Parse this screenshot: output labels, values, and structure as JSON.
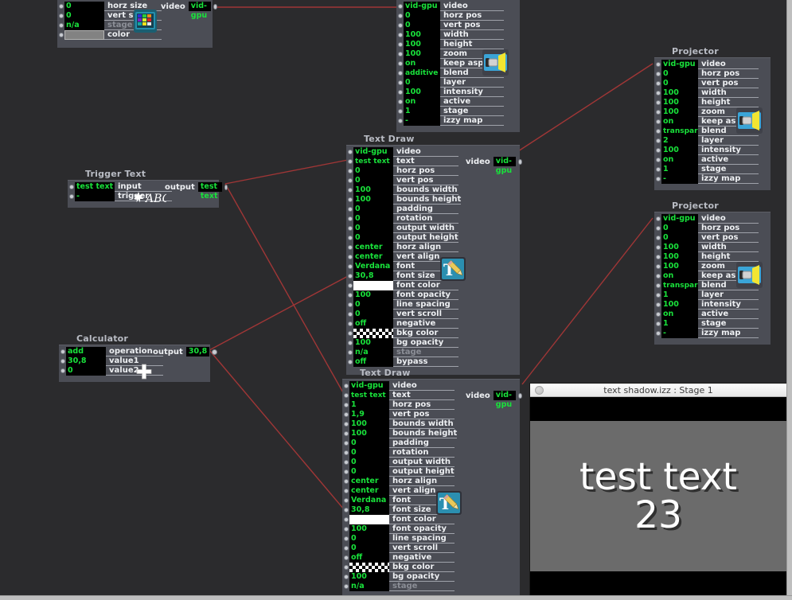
{
  "app": {
    "canvas_bg": "#2b2b2d",
    "node_bg": "#4b4d55",
    "value_color": "#19e23b",
    "wire_color": "#a03636"
  },
  "nodes": {
    "color_gen": {
      "title": "",
      "rows": [
        {
          "value": "0",
          "label": "horz size",
          "type": "text"
        },
        {
          "value": "0",
          "label": "vert size",
          "type": "text"
        },
        {
          "value": "n/a",
          "label": "stage",
          "type": "text",
          "dim": true
        },
        {
          "value": "",
          "label": "color",
          "type": "swatch-grey"
        }
      ],
      "output": {
        "label": "video",
        "value": "vid-gpu"
      },
      "icon": "color-grid-icon"
    },
    "projector_top_left": {
      "title": "",
      "rows": [
        {
          "value": "vid-gpu",
          "label": "video"
        },
        {
          "value": "0",
          "label": "horz pos"
        },
        {
          "value": "0",
          "label": "vert pos"
        },
        {
          "value": "100",
          "label": "width"
        },
        {
          "value": "100",
          "label": "height"
        },
        {
          "value": "100",
          "label": "zoom"
        },
        {
          "value": "on",
          "label": "keep aspect"
        },
        {
          "value": "additive",
          "label": "blend"
        },
        {
          "value": "0",
          "label": "layer"
        },
        {
          "value": "100",
          "label": "intensity"
        },
        {
          "value": "on",
          "label": "active"
        },
        {
          "value": "1",
          "label": "stage"
        },
        {
          "value": "-",
          "label": "izzy map"
        }
      ],
      "icon": "projector-icon"
    },
    "trigger_text": {
      "title": "Trigger Text",
      "rows": [
        {
          "value": "test text",
          "label": "input"
        },
        {
          "value": "-",
          "label": "trigger"
        }
      ],
      "output": {
        "label": "output",
        "value": "test text"
      },
      "icon": "abc-icon"
    },
    "calculator": {
      "title": "Calculator",
      "rows": [
        {
          "value": "add",
          "label": "operation"
        },
        {
          "value": "30,8",
          "label": "value1"
        },
        {
          "value": "0",
          "label": "value2"
        }
      ],
      "output": {
        "label": "output",
        "value": "30,8"
      },
      "icon": "plus-icon"
    },
    "text_draw_top": {
      "title": "Text Draw",
      "rows": [
        {
          "value": "vid-gpu",
          "label": "video"
        },
        {
          "value": "test text",
          "label": "text"
        },
        {
          "value": "0",
          "label": "horz pos"
        },
        {
          "value": "0",
          "label": "vert pos"
        },
        {
          "value": "100",
          "label": "bounds width"
        },
        {
          "value": "100",
          "label": "bounds height"
        },
        {
          "value": "0",
          "label": "padding"
        },
        {
          "value": "0",
          "label": "rotation"
        },
        {
          "value": "0",
          "label": "output width"
        },
        {
          "value": "0",
          "label": "output height"
        },
        {
          "value": "center",
          "label": "horz align"
        },
        {
          "value": "center",
          "label": "vert align"
        },
        {
          "value": "Verdana",
          "label": "font"
        },
        {
          "value": "30,8",
          "label": "font size"
        },
        {
          "value": "",
          "label": "font color",
          "type": "swatch-white"
        },
        {
          "value": "100",
          "label": "font opacity"
        },
        {
          "value": "0",
          "label": "line spacing"
        },
        {
          "value": "0",
          "label": "vert scroll"
        },
        {
          "value": "off",
          "label": "negative"
        },
        {
          "value": "",
          "label": "bkg color",
          "type": "swatch-checker"
        },
        {
          "value": "100",
          "label": "bg opacity"
        },
        {
          "value": "n/a",
          "label": "stage",
          "dim": true
        },
        {
          "value": "off",
          "label": "bypass"
        }
      ],
      "output": {
        "label": "video",
        "value": "vid-gpu"
      },
      "icon": "text-edit-icon"
    },
    "text_draw_bottom": {
      "title": "Text Draw",
      "rows": [
        {
          "value": "vid-gpu",
          "label": "video"
        },
        {
          "value": "test text",
          "label": "text"
        },
        {
          "value": "1",
          "label": "horz pos"
        },
        {
          "value": "1,9",
          "label": "vert pos"
        },
        {
          "value": "100",
          "label": "bounds width"
        },
        {
          "value": "100",
          "label": "bounds height"
        },
        {
          "value": "0",
          "label": "padding"
        },
        {
          "value": "0",
          "label": "rotation"
        },
        {
          "value": "0",
          "label": "output width"
        },
        {
          "value": "0",
          "label": "output height"
        },
        {
          "value": "center",
          "label": "horz align"
        },
        {
          "value": "center",
          "label": "vert align"
        },
        {
          "value": "Verdana",
          "label": "font"
        },
        {
          "value": "30,8",
          "label": "font size"
        },
        {
          "value": "",
          "label": "font color",
          "type": "swatch-white"
        },
        {
          "value": "100",
          "label": "font opacity"
        },
        {
          "value": "0",
          "label": "line spacing"
        },
        {
          "value": "0",
          "label": "vert scroll"
        },
        {
          "value": "off",
          "label": "negative"
        },
        {
          "value": "",
          "label": "bkg color",
          "type": "swatch-checker"
        },
        {
          "value": "100",
          "label": "bg opacity"
        },
        {
          "value": "n/a",
          "label": "stage",
          "dim": true
        }
      ],
      "output": {
        "label": "video",
        "value": "vid-gpu"
      },
      "icon": "text-edit-icon"
    },
    "projector_1": {
      "title": "Projector",
      "rows": [
        {
          "value": "vid-gpu",
          "label": "video"
        },
        {
          "value": "0",
          "label": "horz pos"
        },
        {
          "value": "0",
          "label": "vert pos"
        },
        {
          "value": "100",
          "label": "width"
        },
        {
          "value": "100",
          "label": "height"
        },
        {
          "value": "100",
          "label": "zoom"
        },
        {
          "value": "on",
          "label": "keep aspect"
        },
        {
          "value": "transpar",
          "label": "blend"
        },
        {
          "value": "2",
          "label": "layer"
        },
        {
          "value": "100",
          "label": "intensity"
        },
        {
          "value": "on",
          "label": "active"
        },
        {
          "value": "1",
          "label": "stage"
        },
        {
          "value": "-",
          "label": "izzy map"
        }
      ],
      "icon": "projector-icon"
    },
    "projector_2": {
      "title": "Projector",
      "rows": [
        {
          "value": "vid-gpu",
          "label": "video"
        },
        {
          "value": "0",
          "label": "horz pos"
        },
        {
          "value": "0",
          "label": "vert pos"
        },
        {
          "value": "100",
          "label": "width"
        },
        {
          "value": "100",
          "label": "height"
        },
        {
          "value": "100",
          "label": "zoom"
        },
        {
          "value": "on",
          "label": "keep aspect"
        },
        {
          "value": "transpar",
          "label": "blend"
        },
        {
          "value": "1",
          "label": "layer"
        },
        {
          "value": "100",
          "label": "intensity"
        },
        {
          "value": "on",
          "label": "active"
        },
        {
          "value": "1",
          "label": "stage"
        },
        {
          "value": "-",
          "label": "izzy map"
        }
      ],
      "icon": "projector-icon"
    }
  },
  "stage_window": {
    "title": "text shadow.izz : Stage 1",
    "line1": "test text",
    "line2": "23",
    "bg_color": "#6b6b6b",
    "letterbox_color": "#000000",
    "text_color": "#ffffff"
  }
}
